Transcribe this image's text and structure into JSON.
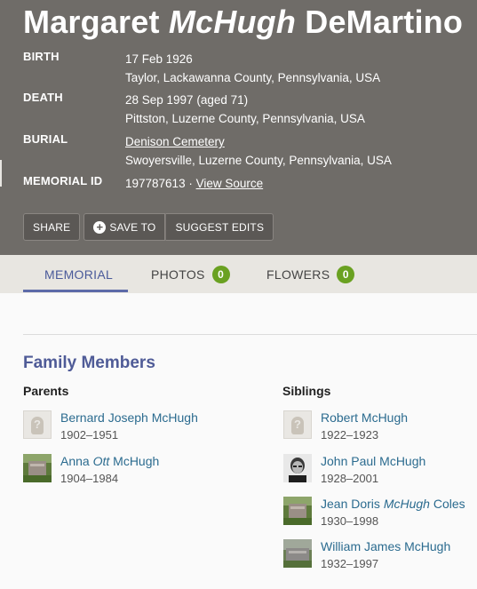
{
  "memorial": {
    "name_first": "Margaret",
    "name_maiden": "McHugh",
    "name_last": "DeMartino",
    "birth_label": "BIRTH",
    "birth_date": "17 Feb 1926",
    "birth_place": "Taylor, Lackawanna County, Pennsylvania, USA",
    "death_label": "DEATH",
    "death_date": "28 Sep 1997 (aged 71)",
    "death_place": "Pittston, Luzerne County, Pennsylvania, USA",
    "burial_label": "BURIAL",
    "burial_cemetery": "Denison Cemetery",
    "burial_place": "Swoyersville, Luzerne County, Pennsylvania, USA",
    "memorial_id_label": "MEMORIAL ID",
    "memorial_id": "197787613 ·",
    "view_source": "View Source"
  },
  "actions": {
    "share": "SHARE",
    "save_to": "SAVE TO",
    "suggest_edits": "SUGGEST EDITS"
  },
  "tabs": {
    "memorial": "MEMORIAL",
    "photos": "PHOTOS",
    "photos_count": "0",
    "flowers": "FLOWERS",
    "flowers_count": "0"
  },
  "family": {
    "title": "Family Members",
    "parents_title": "Parents",
    "siblings_title": "Siblings",
    "parents": [
      {
        "name": "Bernard Joseph McHugh",
        "dates": "1902–1951"
      },
      {
        "name_a": "Anna ",
        "name_i": "Ott",
        "name_b": " McHugh",
        "dates": "1904–1984"
      }
    ],
    "siblings": [
      {
        "name": "Robert McHugh",
        "dates": "1922–1923"
      },
      {
        "name": "John Paul McHugh",
        "dates": "1928–2001"
      },
      {
        "name_a": "Jean Doris ",
        "name_i": "McHugh",
        "name_b": " Coles",
        "dates": "1930–1998"
      },
      {
        "name": "William James McHugh",
        "dates": "1932–1997"
      }
    ]
  },
  "colors": {
    "hero_bg": "#6f6c68",
    "link": "#2b6b8f",
    "accent": "#4f5b97",
    "badge": "#6aa121"
  }
}
